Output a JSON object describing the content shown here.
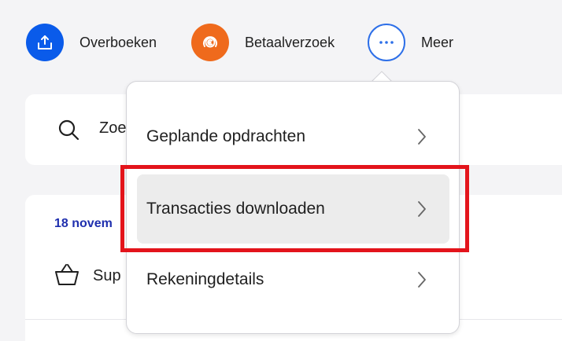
{
  "actions": {
    "transfer_label": "Overboeken",
    "request_label": "Betaalverzoek",
    "more_label": "Meer"
  },
  "search": {
    "visible_text": "Zoe"
  },
  "transactions": {
    "date_visible": "18 novem",
    "merchant_visible": "Sup"
  },
  "menu": {
    "items": [
      {
        "label": "Geplande opdrachten"
      },
      {
        "label": "Transacties downloaden"
      },
      {
        "label": "Rekeningdetails"
      }
    ]
  },
  "colors": {
    "transfer": "#0a5bea",
    "request": "#ef6a1c",
    "more": "#2d6fe8",
    "date": "#1f2fae",
    "highlight": "#e3141b"
  },
  "icons": {
    "transfer": "upload-icon",
    "request": "euro-coin-icon",
    "more": "more-dots-icon",
    "search": "search-icon",
    "basket": "shopping-basket-icon",
    "chevron": "chevron-right-icon"
  }
}
